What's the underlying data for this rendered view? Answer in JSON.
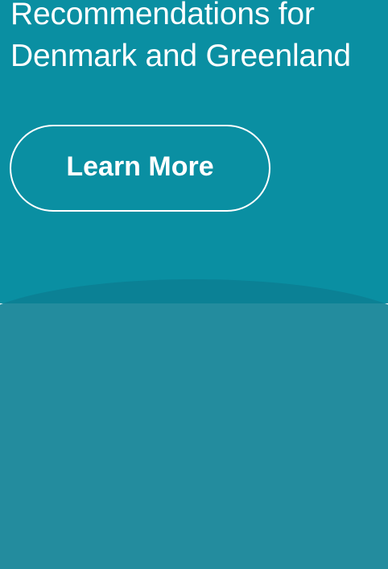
{
  "banner": {
    "headline_line1": "Recommendations for",
    "headline_line2": "Denmark and Greenland",
    "button_label": "Learn More"
  },
  "colors": {
    "background": "#0a8fa2",
    "text": "#ffffff"
  }
}
